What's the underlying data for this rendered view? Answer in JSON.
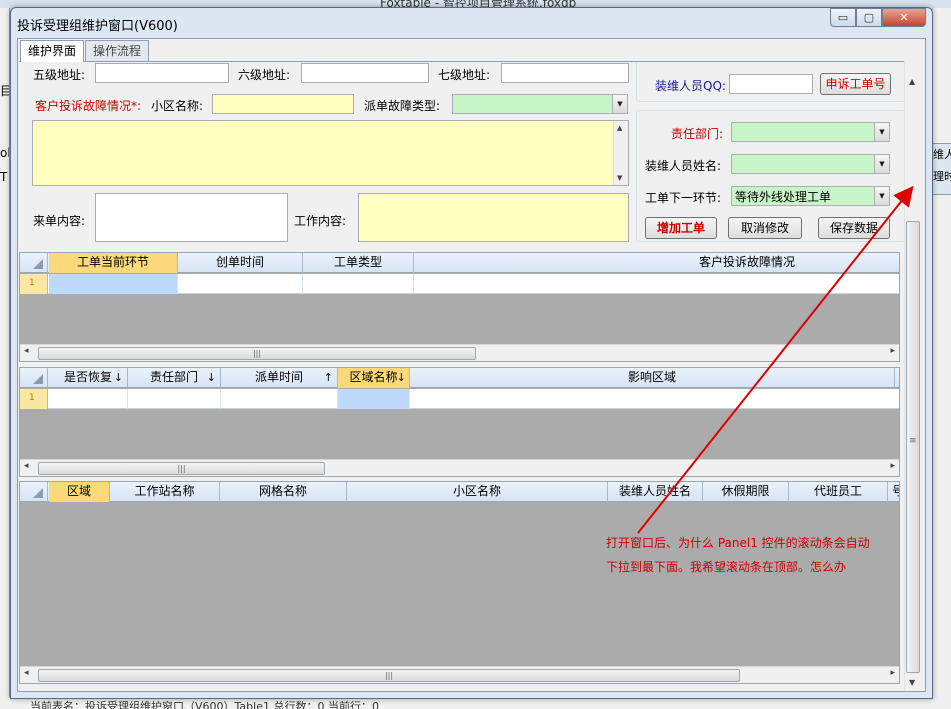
{
  "host": {
    "title": "Foxtable - 智控项目管理系统.foxdb",
    "left_text": [
      "",
      "目",
      "",
      "",
      "ol",
      "T"
    ],
    "right_text": [
      "维人",
      "理时"
    ],
    "status": "当前表名：投诉受理组维护窗口（V600）Table1  总行数：0  当前行：0"
  },
  "window": {
    "title": "投诉受理组维护窗口(V600)",
    "controls": {
      "minimize": "▭",
      "maximize": "▢",
      "close": "✕"
    }
  },
  "tabs": [
    {
      "label": "维护界面"
    },
    {
      "label": "操作流程"
    }
  ],
  "form": {
    "level5_label": "五级地址:",
    "level5_value": "",
    "level6_label": "六级地址:",
    "level6_value": "",
    "level7_label": "七级地址:",
    "level7_value": "",
    "complaint_label": "客户投诉故障情况*:",
    "community_label": "小区名称:",
    "community_value": "",
    "fault_type_label": "派单故障类型:",
    "fault_type_value": "",
    "complaint_text": "",
    "incoming_label": "来单内容:",
    "incoming_value": "",
    "work_label": "工作内容:",
    "work_value": "",
    "qq_label": "装维人员QQ:",
    "qq_value": "",
    "appeal_button": "申诉工单号",
    "dept_label": "责任部门:",
    "dept_value": "",
    "staff_name_label": "装维人员姓名:",
    "staff_name_value": "",
    "next_step_label": "工单下一环节:",
    "next_step_value": "等待外线处理工单",
    "add_button": "增加工单",
    "cancel_button": "取消修改",
    "save_button": "保存数据"
  },
  "grid1": {
    "columns": [
      "工单当前环节",
      "创单时间",
      "工单类型",
      "客户投诉故障情况"
    ],
    "row_number": "1"
  },
  "grid2": {
    "columns": [
      "是否恢复",
      "责任部门",
      "派单时间",
      "区域名称",
      "影响区域"
    ],
    "row_number": "1"
  },
  "grid3": {
    "columns": [
      "区域",
      "工作站名称",
      "网格名称",
      "小区名称",
      "装维人员姓名",
      "休假期限",
      "代班员工",
      "号"
    ]
  },
  "annotation": {
    "line1": "打开窗口后、为什么 Panel1 控件的滚动条会自动",
    "line2": "下拉到最下面。我希望滚动条在顶部。怎么办",
    "color": "#cc0000"
  },
  "colors": {
    "yellow_field": "#ffffc0",
    "green_field": "#c8f5c8",
    "selected_header": "#fbd97a",
    "grid_empty": "#ababab"
  }
}
